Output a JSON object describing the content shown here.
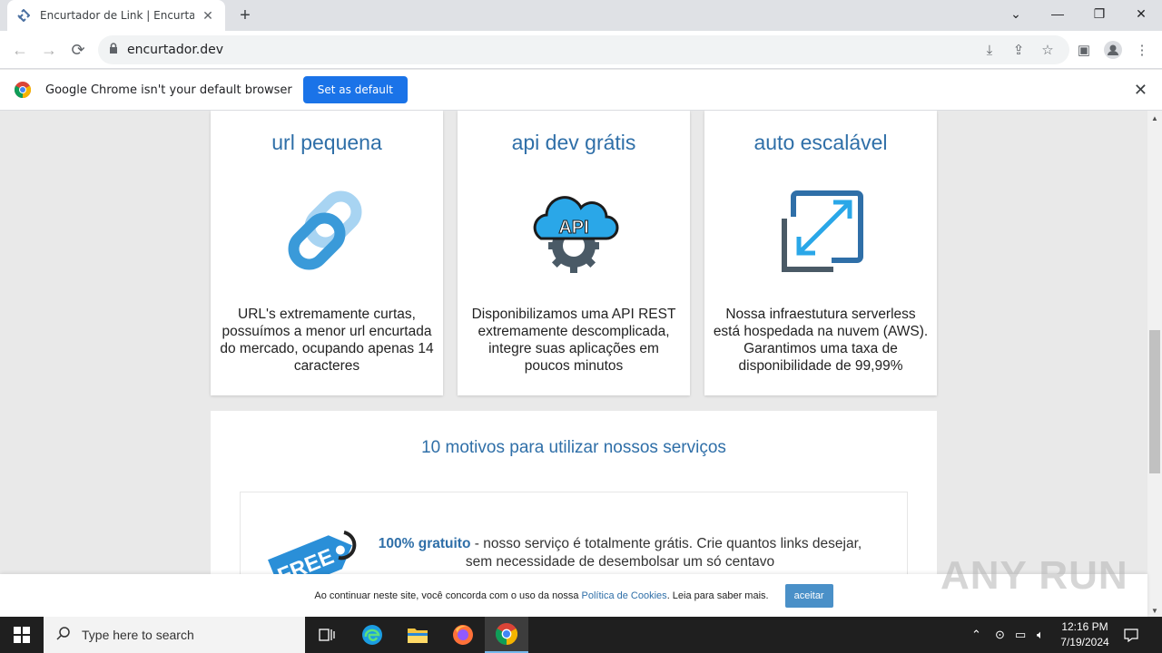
{
  "browser": {
    "tab_title": "Encurtador de Link | Encurtador",
    "url": "encurtador.dev",
    "infobar_message": "Google Chrome isn't your default browser",
    "infobar_button": "Set as default"
  },
  "cards": [
    {
      "title": "url pequena",
      "icon": "chain-link-icon",
      "text": "URL's extremamente curtas, possuímos a menor url encurtada do mercado, ocupando apenas 14 caracteres"
    },
    {
      "title": "api dev grátis",
      "icon": "api-cloud-gear-icon",
      "icon_label": "API",
      "text": "Disponibilizamos uma API REST extremamente descomplicada, integre suas aplicações em poucos minutos"
    },
    {
      "title": "auto escalável",
      "icon": "expand-arrows-icon",
      "text": "Nossa infraestutura serverless está hospedada na nuvem (AWS). Garantimos uma taxa de disponibilidade de 99,99%"
    }
  ],
  "motivos": {
    "heading": "10 motivos para utilizar nossos serviços",
    "item1_bold": "100% gratuito",
    "item1_text": " - nosso serviço é totalmente grátis. Crie quantos links desejar, sem necessidade de desembolsar um só centavo",
    "item1_tag": "FREE"
  },
  "cookie": {
    "text": "Ao continuar neste site, você concorda com o uso da nossa ",
    "link": "Política de Cookies",
    "text_after": ". Leia para saber mais.",
    "button": "aceitar"
  },
  "watermark": "ANY RUN",
  "taskbar": {
    "search_placeholder": "Type here to search",
    "time": "12:16 PM",
    "date": "7/19/2024"
  },
  "colors": {
    "accent_blue": "#2f6fa8",
    "chrome_blue": "#1a73e8"
  }
}
